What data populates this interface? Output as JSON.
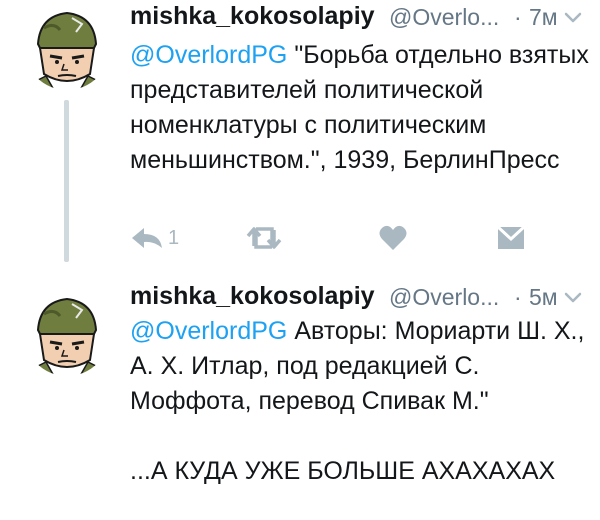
{
  "tweets": [
    {
      "user": {
        "name": "mishka_kokosolapiy",
        "handle": "@Overlo...",
        "avatar": "soldier-helmet-avatar"
      },
      "separator": "·",
      "time": "7м",
      "mention": "@OverlordPG",
      "text": " \"Борьба отдельно взятых представителей политической номенклатуры с политическим меньшинством.\", 1939, БерлинПресс",
      "actions": {
        "reply_count": "1",
        "icons": [
          "reply-icon",
          "retweet-icon",
          "heart-icon",
          "direct-message-icon"
        ]
      }
    },
    {
      "user": {
        "name": "mishka_kokosolapiy",
        "handle": "@Overlo...",
        "avatar": "soldier-helmet-avatar"
      },
      "separator": "·",
      "time": "5м",
      "mention": "@OverlordPG",
      "text": " Авторы: Мориарти Ш. Х., А. Х. Итлар, под редакцией С. Моффота, перевод Спивак М.\"\n\n...А КУДА УЖЕ БОЛЬШЕ АХАХАХАХ"
    }
  ],
  "colors": {
    "link": "#1da1f2",
    "text": "#14171a",
    "meta": "#657786",
    "icon": "#aab8c2",
    "thread_line": "#cfd9de"
  }
}
